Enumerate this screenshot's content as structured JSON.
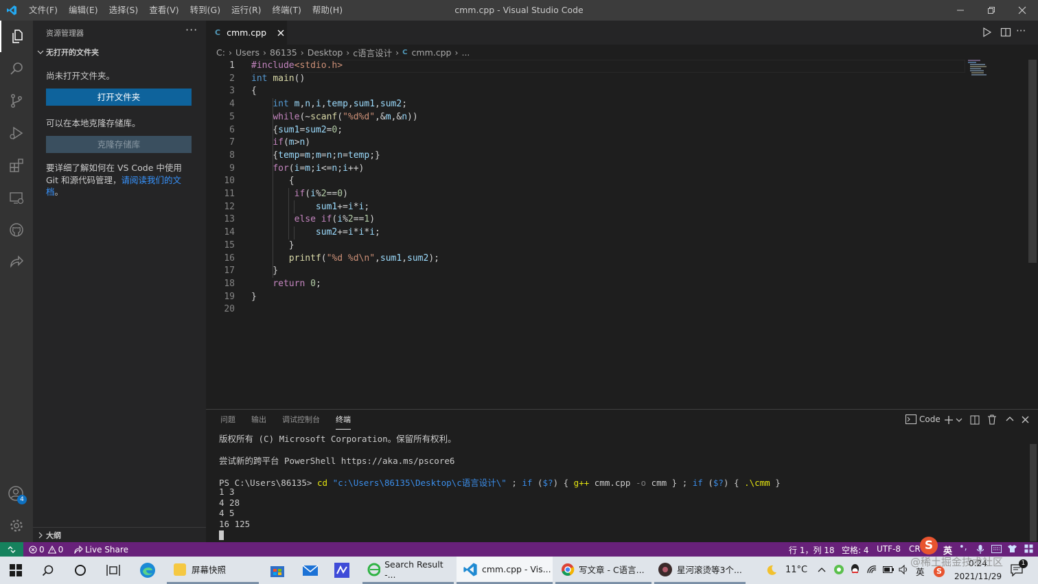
{
  "titlebar": {
    "menus": [
      "文件(F)",
      "编辑(E)",
      "选择(S)",
      "查看(V)",
      "转到(G)",
      "运行(R)",
      "终端(T)",
      "帮助(H)"
    ],
    "title": "cmm.cpp - Visual Studio Code"
  },
  "sidebar": {
    "header": "资源管理器",
    "section": "无打开的文件夹",
    "no_folder_msg": "尚未打开文件夹。",
    "open_folder_btn": "打开文件夹",
    "clone_msg": "可以在本地克隆存储库。",
    "clone_btn": "克隆存储库",
    "learn_text": "要详细了解如何在 VS Code 中使用 Git 和源代码管理，",
    "learn_link": "请阅读我们的文档",
    "learn_end": "。",
    "outline": "大纲"
  },
  "activity": {
    "accounts_badge": "4"
  },
  "editor": {
    "tab_label": "cmm.cpp",
    "breadcrumb": [
      "C:",
      "Users",
      "86135",
      "Desktop",
      "c语言设计",
      "cmm.cpp",
      "..."
    ],
    "line_numbers": [
      "1",
      "2",
      "3",
      "4",
      "5",
      "6",
      "7",
      "8",
      "9",
      "10",
      "11",
      "12",
      "13",
      "14",
      "15",
      "16",
      "17",
      "18",
      "19",
      "20"
    ]
  },
  "panel": {
    "tabs": [
      "问题",
      "输出",
      "调试控制台",
      "终端"
    ],
    "terminal_name": "Code",
    "lines": [
      "版权所有 (C) Microsoft Corporation。保留所有权利。",
      "尝试新的跨平台 PowerShell https://aka.ms/pscore6",
      "PS C:\\Users\\86135> cd \"c:\\Users\\86135\\Desktop\\c语言设计\\\" ; if ($?) { g++ cmm.cpp -o cmm } ; if ($?) { .\\cmm }",
      "1 3",
      "4 28",
      "4 5",
      "16 125"
    ]
  },
  "statusbar": {
    "errors": "0",
    "warnings": "0",
    "live_share": "Live Share",
    "position": "行 1，列 18",
    "spaces": "空格: 4",
    "encoding": "UTF-8",
    "eol": "CRLF"
  },
  "taskbar": {
    "apps": [
      "屏幕快照",
      "Search Result -...",
      "cmm.cpp - Vis...",
      "写文章 - C语言...",
      "星河滚烫等3个..."
    ],
    "temperature": "11°C",
    "time": "0:24",
    "date": "2021/11/29",
    "ime": "英",
    "watermark": "@稀土掘金技术社区"
  }
}
